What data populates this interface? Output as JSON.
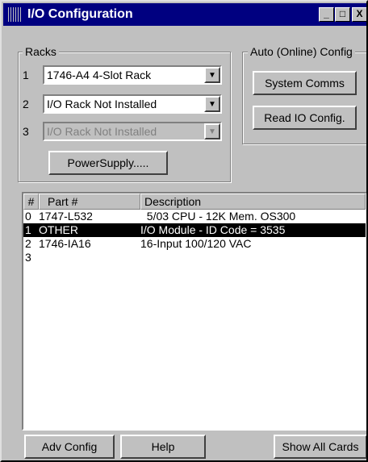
{
  "window": {
    "title": "I/O Configuration",
    "controls": [
      "_",
      "□",
      "X"
    ]
  },
  "racks": {
    "legend": "Racks",
    "rows": [
      {
        "num": "1",
        "value": "1746-A4  4-Slot Rack",
        "disabled": false
      },
      {
        "num": "2",
        "value": "I/O Rack Not Installed",
        "disabled": false
      },
      {
        "num": "3",
        "value": "I/O Rack Not Installed",
        "disabled": true
      }
    ],
    "power_supply_label": "PowerSupply....."
  },
  "auto_config": {
    "legend": "Auto (Online) Config",
    "system_comms_label": "System Comms",
    "read_io_label": "Read IO Config."
  },
  "list": {
    "headers": {
      "num": "#",
      "part": "Part #",
      "desc": "Description"
    },
    "rows": [
      {
        "slot": "0",
        "part": "1747-L532",
        "desc": "  5/03 CPU - 12K Mem. OS300",
        "selected": false
      },
      {
        "slot": "1",
        "part": "OTHER",
        "desc": "I/O Module - ID Code = 3535",
        "selected": true
      },
      {
        "slot": "2",
        "part": "1746-IA16",
        "desc": "16-Input 100/120 VAC",
        "selected": false
      },
      {
        "slot": "3",
        "part": "",
        "desc": "",
        "selected": false
      }
    ]
  },
  "footer": {
    "adv_config_label": "Adv Config",
    "help_label": "Help",
    "show_all_label": "Show All Cards"
  }
}
